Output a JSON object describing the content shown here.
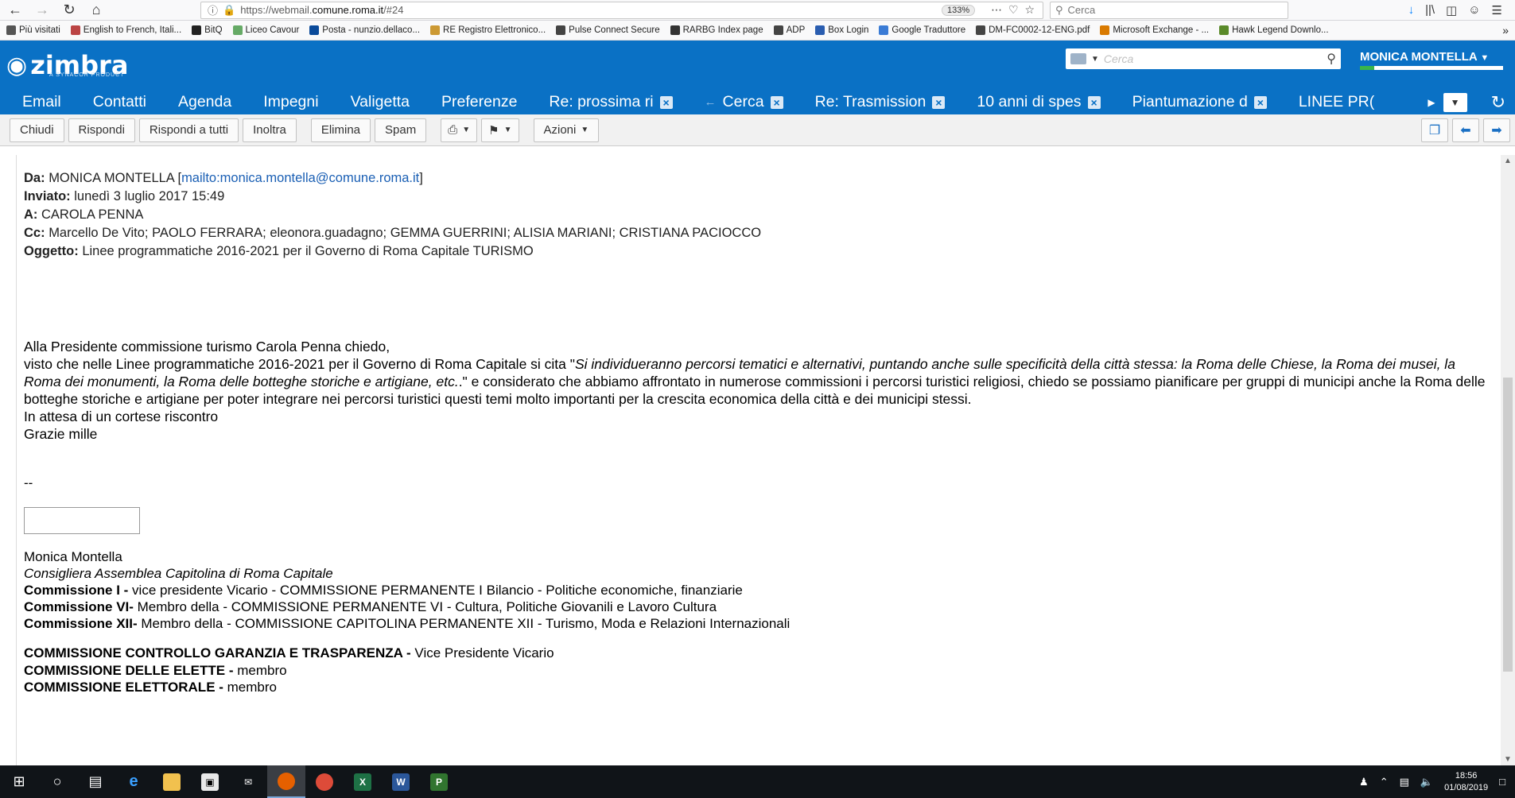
{
  "browser": {
    "url_prefix": "https://webmail.",
    "url_domain": "comune.roma.it",
    "url_suffix": "/#24",
    "zoom": "133%",
    "search_placeholder": "Cerca",
    "bookmarks": [
      "Più visitati",
      "English to French, Itali...",
      "BitQ",
      "Liceo Cavour",
      "Posta - nunzio.dellaco...",
      "RE Registro Elettronico...",
      "Pulse Connect Secure",
      "RARBG Index page",
      "ADP",
      "Box Login",
      "Google Traduttore",
      "DM-FC0002-12-ENG.pdf",
      "Microsoft Exchange - ...",
      "Hawk Legend Downlo..."
    ]
  },
  "zimbra": {
    "logo": "zimbra",
    "logo_sub": "A SYNACOR PRODUCT",
    "search_placeholder": "Cerca",
    "user": "MONICA MONTELLA",
    "tabs": [
      "Email",
      "Contatti",
      "Agenda",
      "Impegni",
      "Valigetta",
      "Preferenze"
    ],
    "doc_tabs": [
      "Re: prossima ri",
      "Cerca",
      "Re: Trasmission",
      "10 anni di spes",
      "Piantumazione d",
      "LINEE PR("
    ],
    "toolbar": {
      "close": "Chiudi",
      "reply": "Rispondi",
      "reply_all": "Rispondi a tutti",
      "forward": "Inoltra",
      "delete": "Elimina",
      "spam": "Spam",
      "actions": "Azioni"
    }
  },
  "message": {
    "from_label": "Da:",
    "from_name": "MONICA MONTELLA [",
    "from_link": "mailto:monica.montella@comune.roma.it",
    "from_close": "]",
    "sent_label": "Inviato:",
    "sent_value": "lunedì 3 luglio 2017 15:49",
    "to_label": "A:",
    "to_value": "CAROLA PENNA",
    "cc_label": "Cc:",
    "cc_value": "Marcello De Vito; PAOLO FERRARA; eleonora.guadagno; GEMMA GUERRINI; ALISIA MARIANI; CRISTIANA PACIOCCO",
    "subject_label": "Oggetto:",
    "subject_value": "Linee programmatiche 2016-2021 per il Governo di Roma Capitale TURISMO",
    "body_line1": "Alla Presidente commissione turismo Carola Penna chiedo,",
    "body_p2_start": "visto che nelle Linee programmatiche 2016-2021 per il Governo di Roma Capitale si cita \"",
    "body_p2_italic": "Si individueranno percorsi tematici e alternativi, puntando anche sulle specificità della città stessa: la Roma delle Chiese, la Roma dei musei, la Roma dei monumenti, la Roma delle botteghe storiche e artigiane, etc.",
    "body_p2_end": ".\" e considerato che abbiamo affrontato in numerose commissioni i percorsi turistici religiosi, chiedo se possiamo pianificare  per gruppi di municipi  anche la Roma delle botteghe storiche e artigiane per poter integrare nei percorsi turistici questi temi molto importanti per la crescita economica della città e dei municipi stessi.",
    "body_line3": "In attesa di un cortese riscontro",
    "body_line4": "Grazie mille",
    "sig_dash": "--",
    "sig_name": "Monica Montella",
    "sig_role": "Consigliera Assemblea Capitolina di Roma Capitale",
    "sig_c1_bold": "Commissione I -",
    "sig_c1": " vice presidente Vicario - COMMISSIONE PERMANENTE I Bilancio - Politiche economiche, finanziarie",
    "sig_c2_bold": "Commissione VI-",
    "sig_c2": " Membro della - COMMISSIONE PERMANENTE VI - Cultura, Politiche Giovanili e Lavoro Cultura",
    "sig_c3_bold": "Commissione XII-",
    "sig_c3": " Membro della - COMMISSIONE CAPITOLINA PERMANENTE XII - Turismo, Moda e Relazioni Internazionali",
    "sig_d1_bold": "COMMISSIONE CONTROLLO GARANZIA E TRASPARENZA -",
    "sig_d1": " Vice Presidente Vicario",
    "sig_d2_bold": "COMMISSIONE DELLE ELETTE -",
    "sig_d2": " membro",
    "sig_d3_bold": "COMMISSIONE ELETTORALE -",
    "sig_d3": " membro"
  },
  "taskbar": {
    "time": "18:56",
    "date": "01/08/2019"
  },
  "colors": {
    "zimbra_blue": "#0a71c5",
    "link": "#1a5fb4"
  }
}
